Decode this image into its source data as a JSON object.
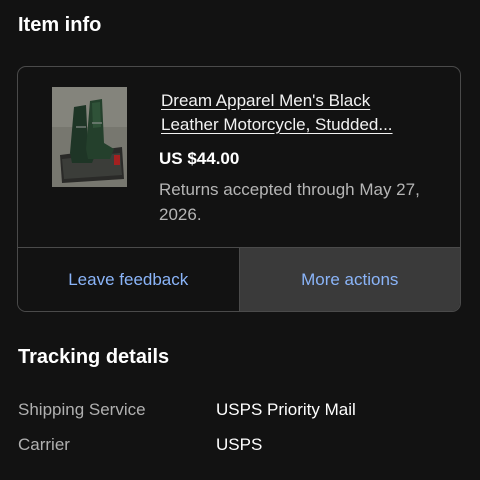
{
  "item_info": {
    "title": "Item info",
    "item": {
      "image_icon": "boots-product-photo",
      "title_line1": "Dream Apparel Men's Black",
      "title_line2": "Leather Motorcycle, Studded...",
      "price": "US $44.00",
      "returns": "Returns accepted through May 27, 2026."
    },
    "actions": {
      "leave_feedback": "Leave feedback",
      "more_actions": "More actions"
    }
  },
  "tracking": {
    "title": "Tracking details",
    "rows": [
      {
        "label": "Shipping Service",
        "value": "USPS Priority Mail"
      },
      {
        "label": "Carrier",
        "value": "USPS"
      }
    ]
  },
  "colors": {
    "background": "#121212",
    "link": "#8ab4f8",
    "border": "#4a4a4a",
    "more_actions_bg": "#3a3a3a"
  }
}
